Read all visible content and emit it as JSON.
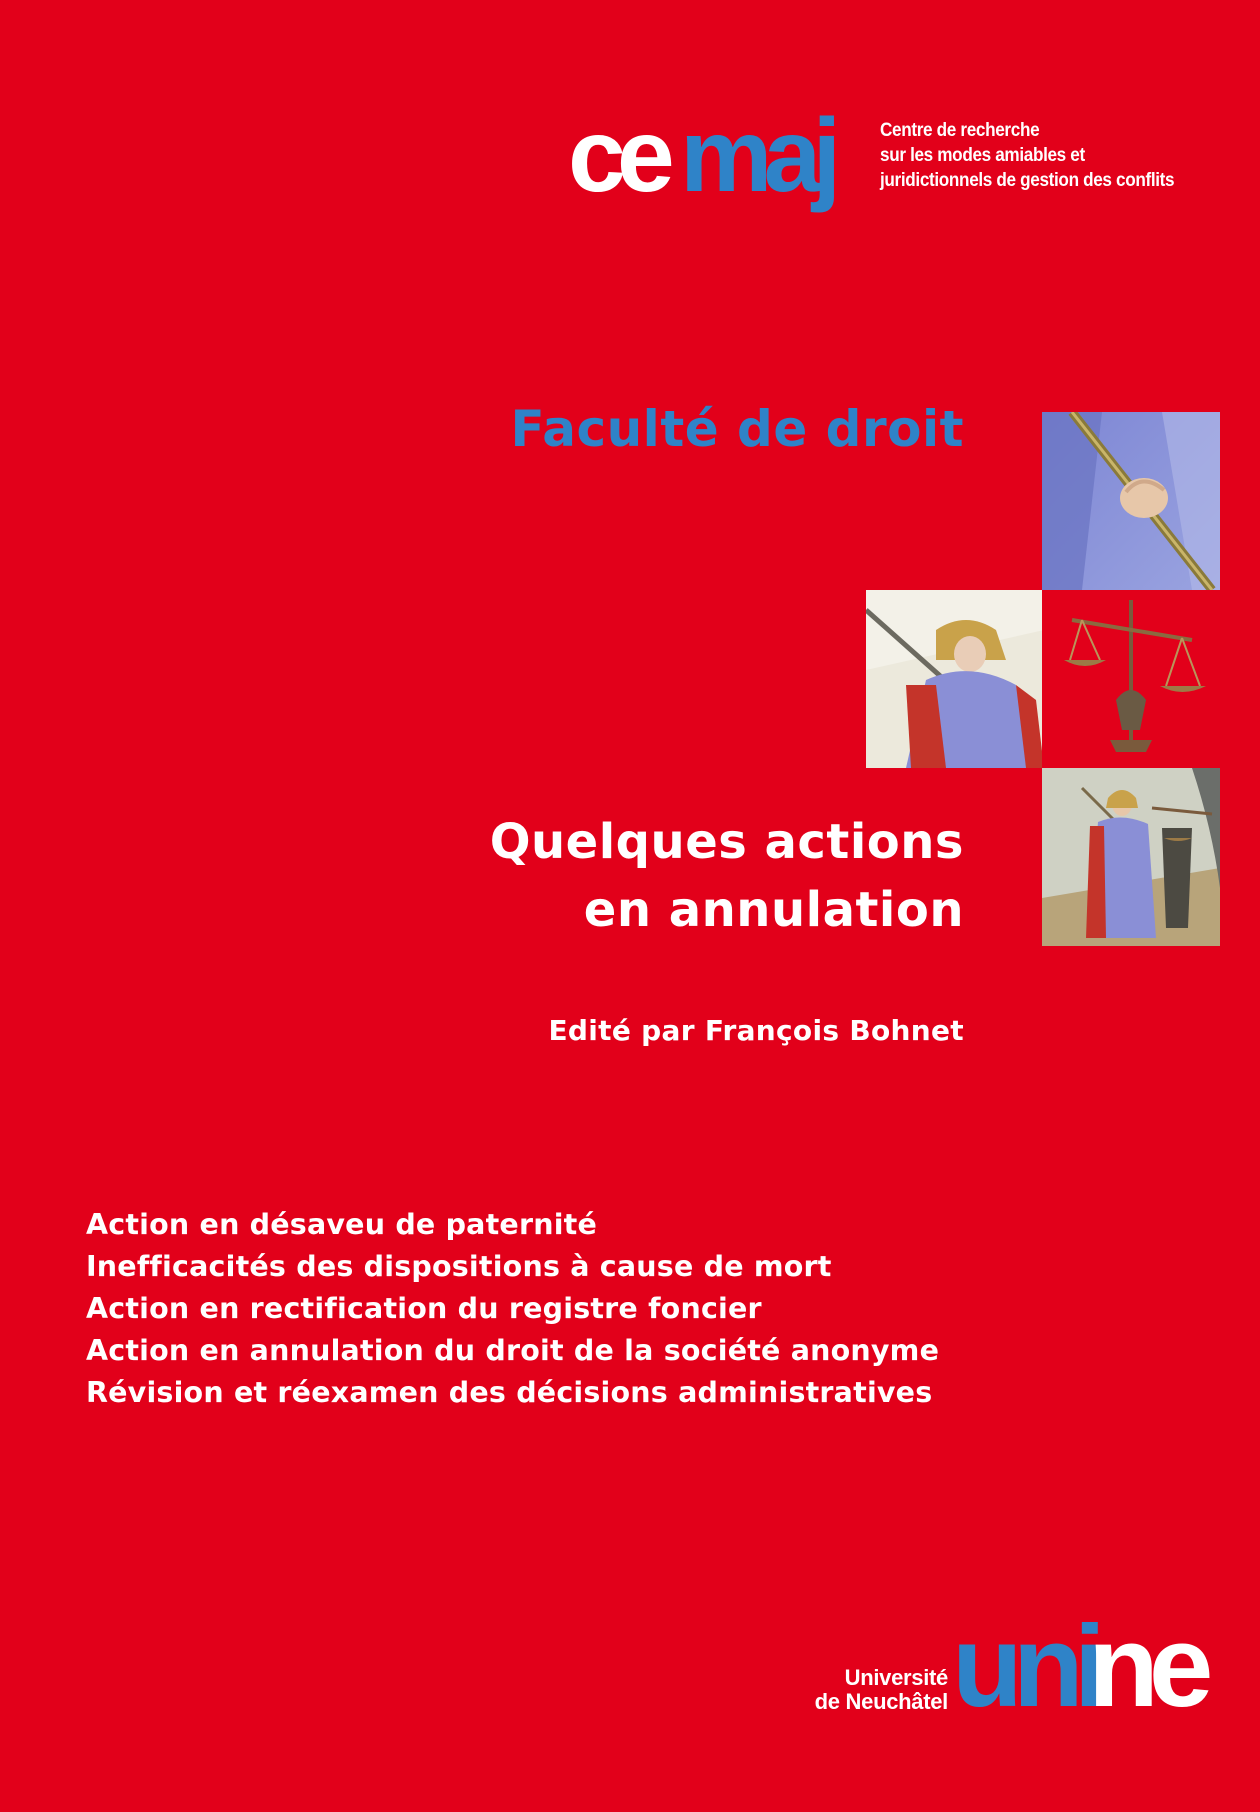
{
  "cemaj": {
    "logo_part1": "ce",
    "logo_part2": "maj",
    "tagline": [
      "Centre de recherche",
      "sur les modes amiables et",
      "juridictionnels de gestion des conflits"
    ]
  },
  "faculty": "Faculté de droit",
  "title": {
    "line1": "Quelques actions",
    "line2": "en annulation"
  },
  "editor": "Edité par François Bohnet",
  "topics": [
    "Action en désaveu de paternité",
    "Inefficacités des dispositions à cause de mort",
    "Action en rectification du registre foncier",
    "Action en annulation du droit de la société anonyme",
    "Révision et réexamen des décisions administratives"
  ],
  "university": {
    "line1": "Université",
    "line2": "de Neuchâtel",
    "logo_part1": "uni",
    "logo_part2": "ne"
  },
  "colors": {
    "background": "#e2001a",
    "accent_blue": "#2f83c8",
    "text": "#ffffff"
  }
}
